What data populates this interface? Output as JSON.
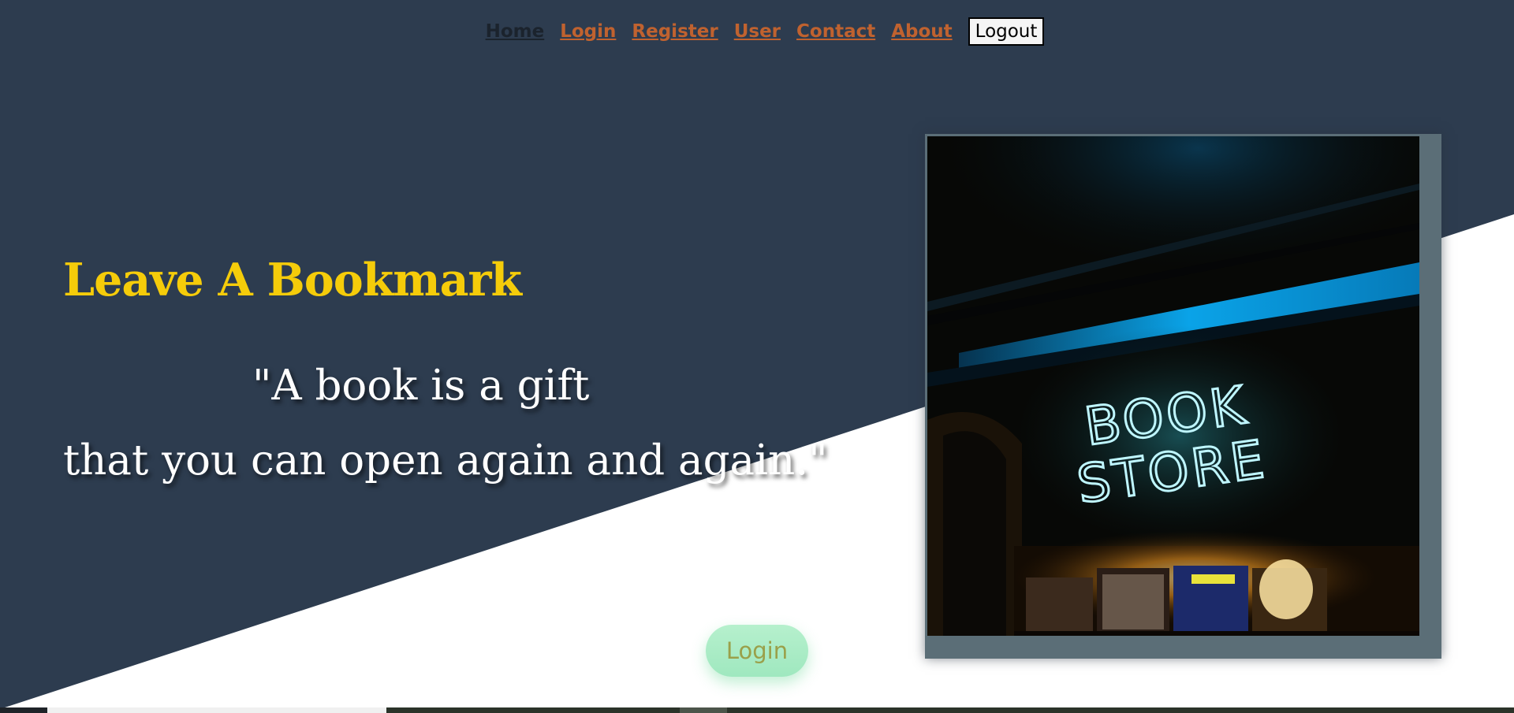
{
  "nav": {
    "links": [
      {
        "label": "Home",
        "active": true
      },
      {
        "label": "Login",
        "active": false
      },
      {
        "label": "Register",
        "active": false
      },
      {
        "label": "User",
        "active": false
      },
      {
        "label": "Contact",
        "active": false
      },
      {
        "label": "About",
        "active": false
      }
    ],
    "logout_label": "Logout"
  },
  "hero": {
    "title": "Leave A Bookmark",
    "quote_line1": "\"A book is a gift",
    "quote_line2": "that you can open again and again.\"",
    "image": {
      "sign_line1": "BOOK",
      "sign_line2": "STORE"
    },
    "cta_label": "Login"
  },
  "colors": {
    "hero_background": "#2d3c4f",
    "title": "#f5cc0a",
    "nav_link": "#c0622f",
    "nav_active": "#1b232d",
    "cta_background": "#a8ecc5",
    "cta_text": "#9aa04a",
    "neon": "#bff6ff",
    "light_beam": "#0b8ad0"
  }
}
